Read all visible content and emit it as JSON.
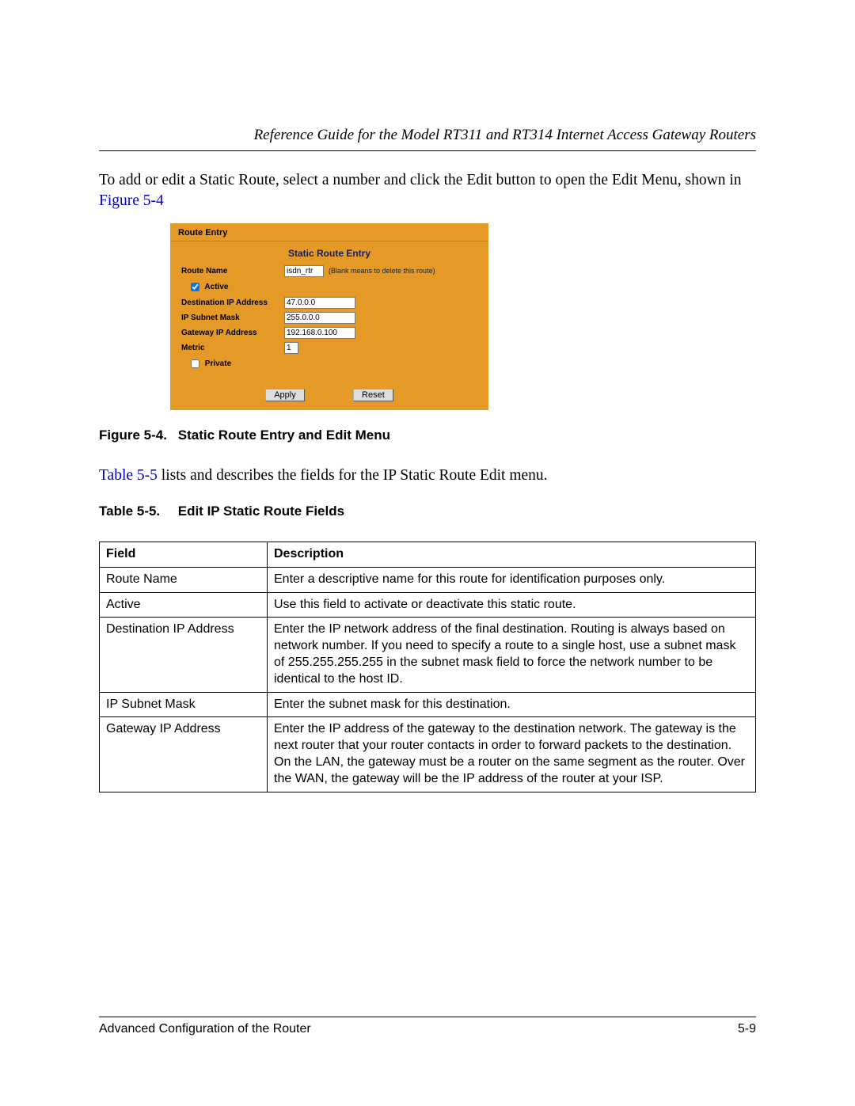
{
  "header": {
    "doc_title": "Reference Guide for the Model RT311 and RT314 Internet Access Gateway Routers"
  },
  "intro": {
    "text_before_link": "To add or edit a Static Route, select a number and click the Edit button to open the Edit Menu, shown in ",
    "link": "Figure 5-4"
  },
  "figure": {
    "panel_header": "Route Entry",
    "panel_title": "Static Route Entry",
    "route_name_label": "Route Name",
    "route_name_value": "isdn_rtr",
    "route_name_hint": "(Blank means to delete this route)",
    "active_label": "Active",
    "dest_ip_label": "Destination IP Address",
    "dest_ip_value": "47.0.0.0",
    "subnet_label": "IP Subnet Mask",
    "subnet_value": "255.0.0.0",
    "gateway_label": "Gateway IP Address",
    "gateway_value": "192.168.0.100",
    "metric_label": "Metric",
    "metric_value": "1",
    "private_label": "Private",
    "apply_button": "Apply",
    "reset_button": "Reset",
    "caption_num": "Figure 5-4.",
    "caption_text": "Static Route Entry and Edit Menu"
  },
  "post_figure": {
    "link": "Table 5-5",
    "text_after": " lists and describes the fields for the IP Static Route Edit menu."
  },
  "table": {
    "caption_num": "Table 5-5.",
    "caption_text": "Edit IP Static Route Fields",
    "headers": {
      "field": "Field",
      "desc": "Description"
    },
    "rows": [
      {
        "field": "Route Name",
        "desc": "Enter a descriptive name for this route for identification purposes only."
      },
      {
        "field": "Active",
        "desc": "Use this field to activate or deactivate this static route."
      },
      {
        "field": "Destination IP Address",
        "desc": "Enter the IP network address of the final destination. Routing is always based on network number. If you need to specify a route to a single host, use a subnet mask of 255.255.255.255 in the subnet mask field to force the network number to be identical to the host ID."
      },
      {
        "field": "IP Subnet Mask",
        "desc": "Enter the subnet mask for this destination."
      },
      {
        "field": "Gateway IP Address",
        "desc": "Enter the IP address of the gateway to the destination network. The gateway is the next router that your router contacts in order to forward packets to the destination. On the LAN, the gateway must be a router on the same segment as the router. Over the WAN, the gateway will be the IP address of the router at your ISP."
      }
    ]
  },
  "footer": {
    "left": "Advanced Configuration of the Router",
    "right": "5-9"
  }
}
